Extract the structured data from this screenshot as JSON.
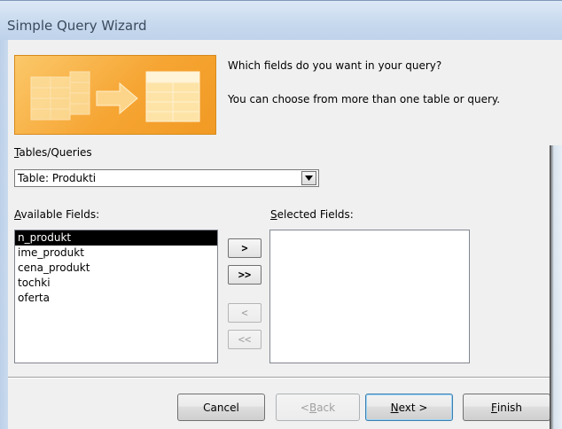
{
  "window": {
    "title": "Simple Query Wizard"
  },
  "header": {
    "prompt_line1": "Which fields do you want in your query?",
    "prompt_line2": "You can choose from more than one table or query."
  },
  "tables": {
    "label_prefix": "T",
    "label_rest": "ables/Queries",
    "selected": "Table: Produkti"
  },
  "available": {
    "label_prefix": "A",
    "label_rest": "vailable Fields:",
    "items": [
      "n_produkt",
      "ime_produkt",
      "cena_produkt",
      "tochki",
      "oferta"
    ],
    "selected_index": 0
  },
  "selected_fields": {
    "label_prefix": "S",
    "label_rest": "elected Fields:",
    "items": []
  },
  "move_buttons": {
    "add_one": ">",
    "add_all": ">>",
    "remove_one": "<",
    "remove_all": "<<"
  },
  "footer": {
    "cancel": "Cancel",
    "back_prefix": "< ",
    "back_key": "B",
    "back_rest": "ack",
    "next_key": "N",
    "next_rest": "ext >",
    "finish_key": "F",
    "finish_rest": "inish"
  },
  "colors": {
    "banner_orange": "#f6a533",
    "selection": "#000000",
    "default_button_border": "#3c7fb1"
  }
}
